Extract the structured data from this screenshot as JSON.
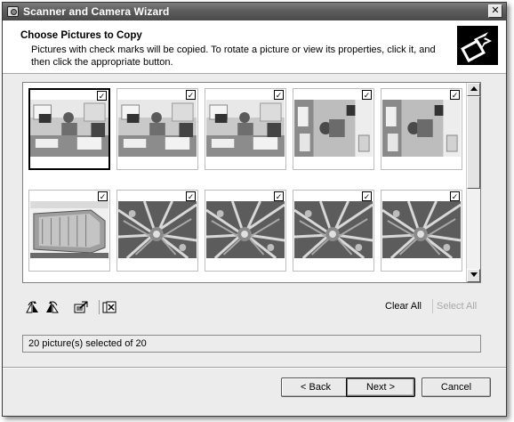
{
  "window": {
    "title": "Scanner and Camera Wizard",
    "close_glyph": "✕"
  },
  "header": {
    "title": "Choose Pictures to Copy",
    "subtitle": "Pictures with check marks will be copied. To rotate a picture or view its properties, click it, and then click the appropriate button."
  },
  "thumbnails": [
    {
      "subject": "man-at-desk",
      "checked": true,
      "selected": true
    },
    {
      "subject": "man-at-desk",
      "checked": true,
      "selected": false
    },
    {
      "subject": "man-at-desk",
      "checked": true,
      "selected": false
    },
    {
      "subject": "man-at-desk-rotated",
      "checked": true,
      "selected": false
    },
    {
      "subject": "man-at-desk-rotated",
      "checked": true,
      "selected": false
    },
    {
      "subject": "glass-box",
      "checked": true,
      "selected": false
    },
    {
      "subject": "plant-leaves",
      "checked": true,
      "selected": false
    },
    {
      "subject": "plant-leaves",
      "checked": true,
      "selected": false
    },
    {
      "subject": "plant-leaves",
      "checked": true,
      "selected": false
    },
    {
      "subject": "plant-leaves",
      "checked": true,
      "selected": false
    }
  ],
  "check_glyph": "✓",
  "toolbar": {
    "icons": [
      "rotate-clockwise-icon",
      "rotate-counterclockwise-icon",
      "properties-icon",
      "delete-icon"
    ],
    "clear_all": "Clear All",
    "select_all": "Select All"
  },
  "status": {
    "text": "20 picture(s) selected of 20"
  },
  "buttons": {
    "back": "< Back",
    "next": "Next >",
    "cancel": "Cancel"
  }
}
